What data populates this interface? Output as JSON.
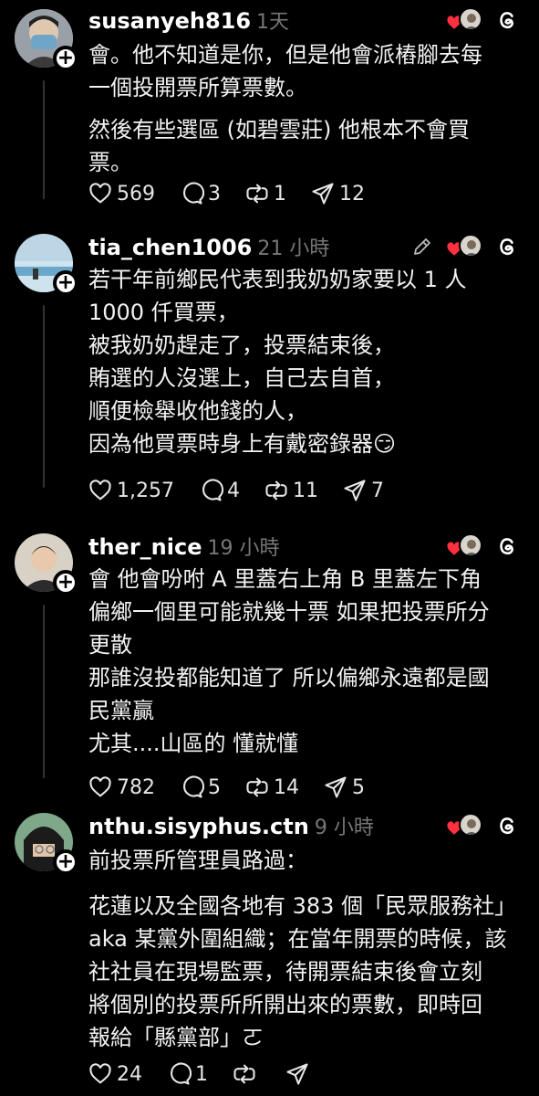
{
  "posts": [
    {
      "username": "susanyeh816",
      "time": "1天",
      "lines": [
        "會。他不知道是你，但是他會派樁腳去每",
        "一個投開票所算票數。",
        "然後有些選區 (如碧雲莊) 他根本不會買",
        "票。"
      ],
      "likes": "569",
      "replies": "3",
      "reposts": "1",
      "shares": "12"
    },
    {
      "username": "tia_chen1006",
      "time": "21 小時",
      "lines": [
        "若干年前鄉民代表到我奶奶家要以 1 人",
        "1000 仟買票，",
        "被我奶奶趕走了，投票結束後，",
        "賄選的人沒選上，自己去自首，",
        "順便檢舉收他錢的人，",
        "因為他買票時身上有戴密錄器😏"
      ],
      "likes": "1,257",
      "replies": "4",
      "reposts": "11",
      "shares": "7"
    },
    {
      "username": "ther_nice",
      "time": "19 小時",
      "lines": [
        "會 他會吩咐 A 里蓋右上角 B 里蓋左下角",
        "偏鄉一個里可能就幾十票 如果把投票所分",
        "更散",
        "那誰沒投都能知道了 所以偏鄉永遠都是國",
        "民黨贏",
        "尤其....山區的 懂就懂"
      ],
      "likes": "782",
      "replies": "5",
      "reposts": "14",
      "shares": "5"
    },
    {
      "username": "nthu.sisyphus.ctn",
      "time": "9 小時",
      "lines": [
        "前投票所管理員路過：",
        "",
        "花蓮以及全國各地有 383 個「民眾服務社」",
        "aka 某黨外圍組織；在當年開票的時候，該",
        "社社員在現場監票，待開票結束後會立刻",
        "將個別的投票所所開出來的票數，即時回",
        "報給「縣黨部」ㄛ"
      ],
      "likes": "24",
      "replies": "1",
      "reposts": "",
      "shares": ""
    }
  ],
  "colors": {
    "background": "#000000",
    "text": "#ffffff",
    "muted": "#777777",
    "heart": "#ff3040"
  },
  "icons": [
    "heart-icon",
    "comment-icon",
    "repost-icon",
    "share-icon",
    "threads-logo-icon",
    "edit-icon",
    "plus-icon"
  ]
}
